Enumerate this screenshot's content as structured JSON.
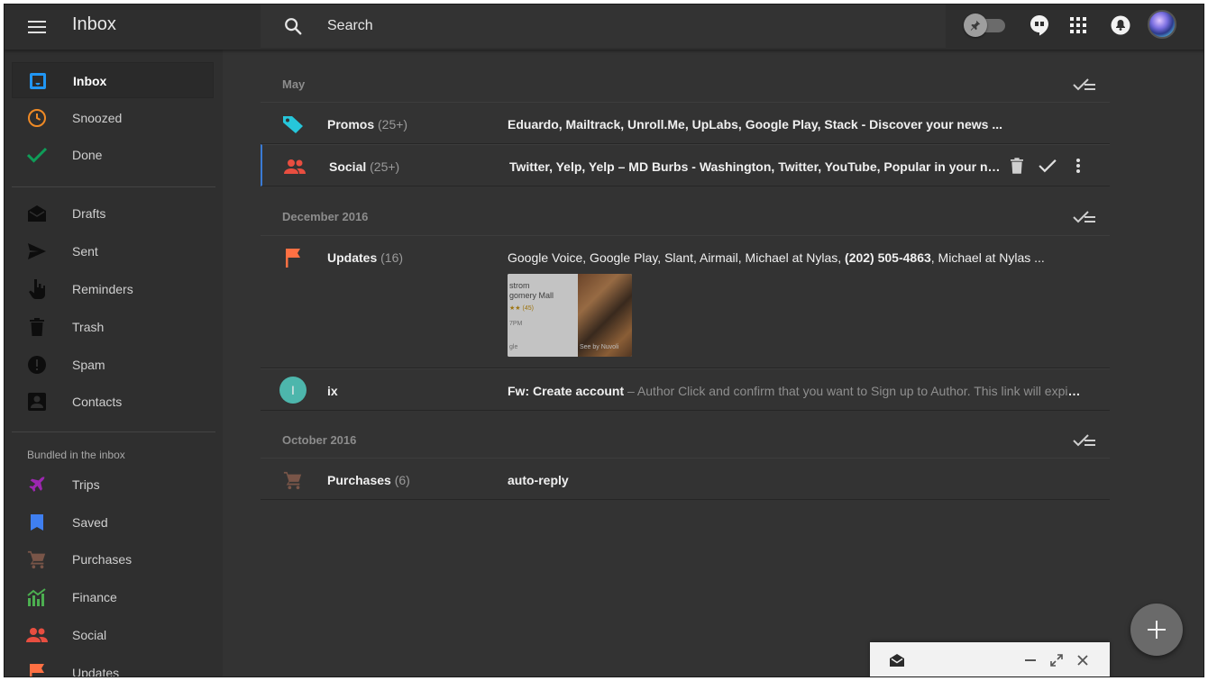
{
  "app": {
    "title": "Inbox"
  },
  "search": {
    "placeholder": "Search"
  },
  "sidebar": {
    "primary": [
      {
        "label": "Inbox",
        "icon": "inbox-icon",
        "color": "#2196f3",
        "active": true
      },
      {
        "label": "Snoozed",
        "icon": "clock-icon",
        "color": "#ef8a25"
      },
      {
        "label": "Done",
        "icon": "check-icon",
        "color": "#0f9d58"
      }
    ],
    "secondary": [
      {
        "label": "Drafts",
        "icon": "draft-icon"
      },
      {
        "label": "Sent",
        "icon": "send-icon"
      },
      {
        "label": "Reminders",
        "icon": "reminder-hand-icon"
      },
      {
        "label": "Trash",
        "icon": "trash-icon"
      },
      {
        "label": "Spam",
        "icon": "spam-icon"
      },
      {
        "label": "Contacts",
        "icon": "contacts-icon"
      }
    ],
    "bundled_heading": "Bundled in the inbox",
    "bundles": [
      {
        "label": "Trips",
        "icon": "plane-icon",
        "color": "#9c27b0"
      },
      {
        "label": "Saved",
        "icon": "bookmark-icon",
        "color": "#3f7ff0"
      },
      {
        "label": "Purchases",
        "icon": "cart-icon",
        "color": "#795548"
      },
      {
        "label": "Finance",
        "icon": "finance-chart-icon",
        "color": "#4caf50"
      },
      {
        "label": "Social",
        "icon": "people-icon",
        "color": "#e84e40"
      },
      {
        "label": "Updates",
        "icon": "flag-icon",
        "color": "#ff7043"
      }
    ]
  },
  "sections": [
    {
      "title": "May"
    },
    {
      "title": "December 2016"
    },
    {
      "title": "October 2016"
    }
  ],
  "rows": {
    "promos": {
      "sender": "Promos",
      "count": "(25+)",
      "snippet": "Eduardo, Mailtrack, Unroll.Me, UpLabs, Google Play, Stack - Discover your news ..."
    },
    "social": {
      "sender": "Social",
      "count": "(25+)",
      "snippet": "Twitter, Yelp, Yelp – MD Burbs - Washington, Twitter, YouTube, Popular in your network..."
    },
    "updates": {
      "sender": "Updates",
      "count": "(16)",
      "snippet_a": "Google Voice, Google Play, Slant, Airmail, Michael at Nylas, ",
      "snippet_b": "(202) 505-4863",
      "snippet_c": ", Michael at Nylas ...",
      "thumb": {
        "line1": "strom",
        "line2": "gomery Mall",
        "line3": "★★ (45)",
        "line4": "7PM",
        "line5": "gle",
        "line6": "See by Nuvoli"
      }
    },
    "ix": {
      "initial": "I",
      "sender": "ix",
      "subject": "Fw: Create account",
      "preview": " – Author Click and confirm that you want to Sign up to Author. This link will expire i..."
    },
    "purchases": {
      "sender": "Purchases",
      "count": "(6)",
      "snippet": "auto-reply"
    }
  }
}
